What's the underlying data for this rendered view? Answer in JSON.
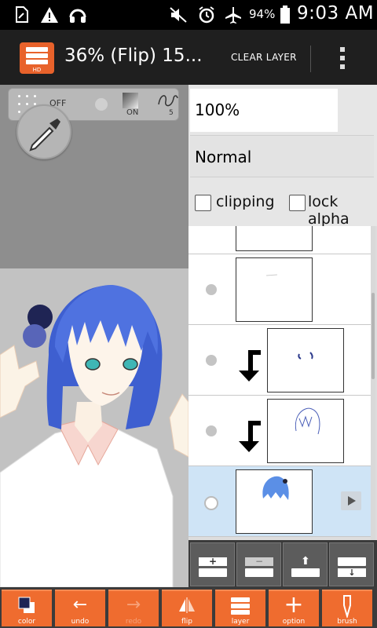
{
  "status_bar": {
    "battery_percent": "94%",
    "time": "9:03 AM",
    "icons": [
      "sim-card-icon",
      "warning-icon",
      "headphones-icon",
      "mute-icon",
      "alarm-icon",
      "airplane-mode-icon",
      "battery-icon"
    ]
  },
  "action_bar": {
    "title": "36% (Flip) 15...",
    "hd_badge": "HD",
    "clear_layer_label": "CLEAR LAYER",
    "accent_color": "#e8622b"
  },
  "tool_bar": {
    "snap_toggle_label": "OFF",
    "gradient_toggle_label": "ON",
    "brush_size": "5"
  },
  "layer_panel": {
    "opacity": "100%",
    "blend_mode": "Normal",
    "clipping_label": "clipping",
    "lock_alpha_label": "lock alpha",
    "layers": [
      {
        "content": "partial",
        "clipped": false,
        "selected": false
      },
      {
        "content": "sketch-marks",
        "clipped": false,
        "selected": false
      },
      {
        "content": "eyes",
        "clipped": true,
        "selected": false
      },
      {
        "content": "hair-lineart",
        "clipped": true,
        "selected": false
      },
      {
        "content": "hair-color",
        "clipped": false,
        "selected": true
      }
    ],
    "buttons": [
      "add-layer",
      "delete-layer",
      "move-layer-up",
      "merge-layer-down"
    ]
  },
  "bottom_bar": {
    "buttons": [
      {
        "label": "color",
        "icon": "color-swatch-icon",
        "enabled": true
      },
      {
        "label": "undo",
        "icon": "undo-arrow-icon",
        "enabled": true
      },
      {
        "label": "redo",
        "icon": "redo-arrow-icon",
        "enabled": false
      },
      {
        "label": "flip",
        "icon": "flip-icon",
        "enabled": true
      },
      {
        "label": "layer",
        "icon": "layers-icon",
        "enabled": true
      },
      {
        "label": "option",
        "icon": "plus-icon",
        "enabled": true
      },
      {
        "label": "brush",
        "icon": "brush-icon",
        "enabled": true
      }
    ],
    "accent_color": "#ef6c2f"
  },
  "palette_colors": [
    "#1f2454",
    "#5865b8"
  ]
}
